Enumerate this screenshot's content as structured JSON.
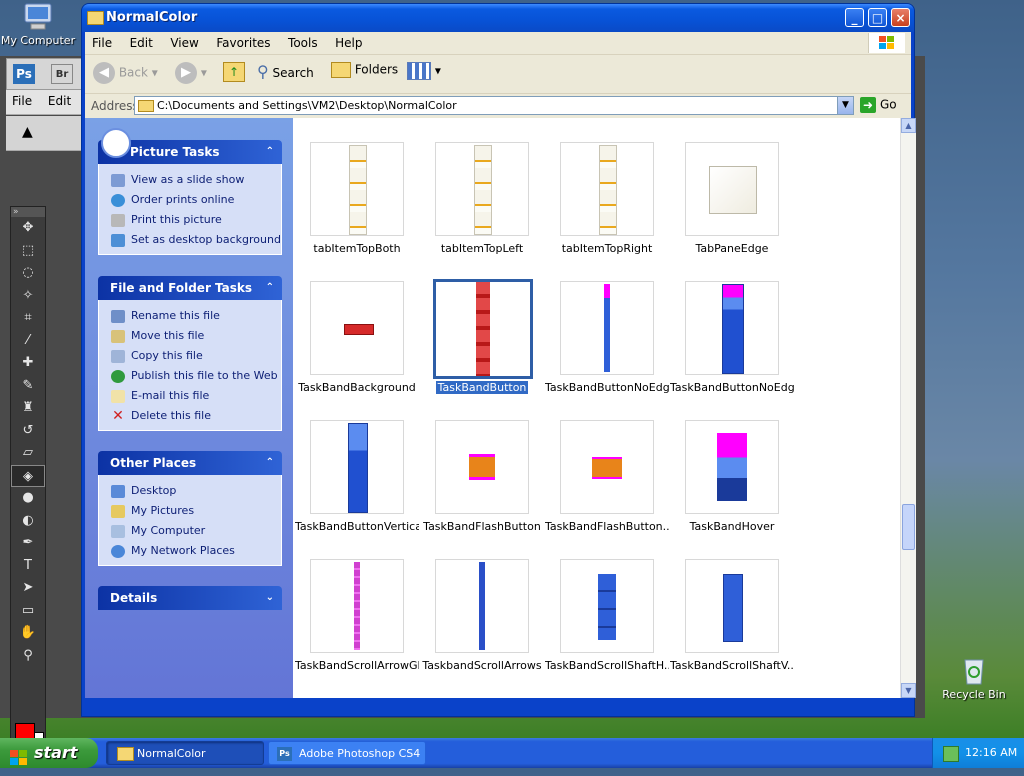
{
  "desktop": {
    "my_computer_label": "My Computer",
    "recycle_bin_label": "Recycle Bin"
  },
  "photoshop": {
    "badge_ps": "Ps",
    "badge_br": "Br",
    "menu_file": "File",
    "menu_edit": "Edit"
  },
  "window": {
    "title": "NormalColor",
    "minimize": "_",
    "maximize": "□",
    "close": "×"
  },
  "menu": {
    "items": [
      "File",
      "Edit",
      "View",
      "Favorites",
      "Tools",
      "Help"
    ]
  },
  "toolbar": {
    "back_label": "Back",
    "search_label": "Search",
    "folders_label": "Folders"
  },
  "address": {
    "label": "Address",
    "value": "C:\\Documents and Settings\\VM2\\Desktop\\NormalColor",
    "go_label": "Go"
  },
  "task_pane": {
    "picture_tasks": {
      "title": "Picture Tasks",
      "items": [
        "View as a slide show",
        "Order prints online",
        "Print this picture",
        "Set as desktop background"
      ]
    },
    "file_folder_tasks": {
      "title": "File and Folder Tasks",
      "items": [
        "Rename this file",
        "Move this file",
        "Copy this file",
        "Publish this file to the Web",
        "E-mail this file",
        "Delete this file"
      ]
    },
    "other_places": {
      "title": "Other Places",
      "items": [
        "Desktop",
        "My Pictures",
        "My Computer",
        "My Network Places"
      ]
    },
    "details": {
      "title": "Details"
    }
  },
  "files": {
    "items": [
      {
        "name": "tabItemTopBoth",
        "selected": false
      },
      {
        "name": "tabItemTopLeft",
        "selected": false
      },
      {
        "name": "tabItemTopRight",
        "selected": false
      },
      {
        "name": "TabPaneEdge",
        "selected": false
      },
      {
        "name": "TaskBandBackground",
        "selected": false
      },
      {
        "name": "TaskBandButton",
        "selected": true
      },
      {
        "name": "TaskBandButtonNoEdge",
        "selected": false
      },
      {
        "name": "TaskBandButtonNoEdg...",
        "selected": false
      },
      {
        "name": "TaskBandButtonVertical",
        "selected": false
      },
      {
        "name": "TaskBandFlashButton",
        "selected": false
      },
      {
        "name": "TaskBandFlashButton...",
        "selected": false
      },
      {
        "name": "TaskBandHover",
        "selected": false
      },
      {
        "name": "TaskBandScrollArrowGl...",
        "selected": false
      },
      {
        "name": "TaskbandScrollArrows",
        "selected": false
      },
      {
        "name": "TaskBandScrollShaftH...",
        "selected": false
      },
      {
        "name": "TaskBandScrollShaftV...",
        "selected": false
      }
    ]
  },
  "taskbar": {
    "start_label": "start",
    "buttons": [
      "NormalColor",
      "Adobe Photoshop CS4"
    ],
    "clock": "12:16 AM"
  },
  "colors": {
    "xp_blue": "#0a42c9",
    "selection": "#316ac5",
    "task_text": "#0c1e74",
    "photoshop_fg": "#ff0000"
  }
}
